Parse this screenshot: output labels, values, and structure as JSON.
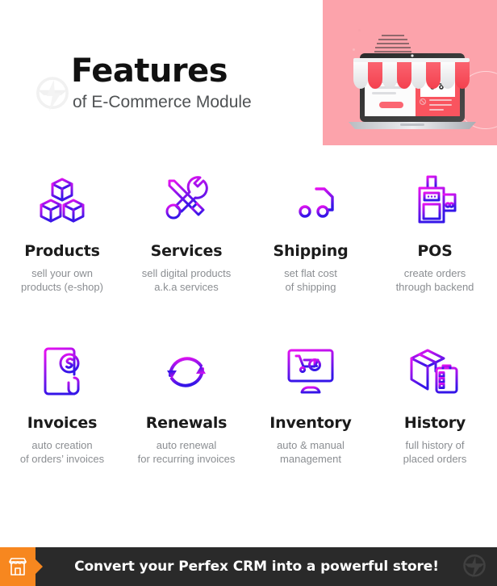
{
  "header": {
    "title": "Features",
    "subtitle": "of E-Commerce Module",
    "watermark_logo_name": "perfex-bolt-logo-icon",
    "hero_illustration_name": "laptop-storefront-illustration",
    "accent_pink": "#FCA3AB",
    "accent_red": "#F8666F"
  },
  "features": {
    "row1": [
      {
        "icon": "boxes-icon",
        "title": "Products",
        "desc_line1": "sell your own",
        "desc_line2": "products (e-shop)"
      },
      {
        "icon": "wrench-screwdriver-icon",
        "title": "Services",
        "desc_line1": "sell digital products",
        "desc_line2": "a.k.a services"
      },
      {
        "icon": "delivery-truck-icon",
        "title": "Shipping",
        "desc_line1": "set flat cost",
        "desc_line2": "of shipping"
      },
      {
        "icon": "pos-terminal-icon",
        "title": "POS",
        "desc_line1": "create orders",
        "desc_line2": "through backend"
      }
    ],
    "row2": [
      {
        "icon": "invoice-dollar-icon",
        "title": "Invoices",
        "desc_line1": "auto creation",
        "desc_line2": "of orders’ invoices"
      },
      {
        "icon": "circular-arrows-renew-icon",
        "title": "Renewals",
        "desc_line1": "auto renewal",
        "desc_line2": "for recurring invoices"
      },
      {
        "icon": "monitor-cart-icon",
        "title": "Inventory",
        "desc_line1": "auto & manual",
        "desc_line2": "management"
      },
      {
        "icon": "box-clipboard-icon",
        "title": "History",
        "desc_line1": "full history of",
        "desc_line2": "placed orders"
      }
    ],
    "gradient_start": "#E611F0",
    "gradient_end": "#3415E8"
  },
  "footer": {
    "badge_icon": "storefront-icon",
    "text": "Convert your Perfex CRM into a powerful store!",
    "watermark_logo_name": "perfex-bolt-logo-icon",
    "background": "#2a2a2a",
    "badge_color": "#F7871F"
  }
}
